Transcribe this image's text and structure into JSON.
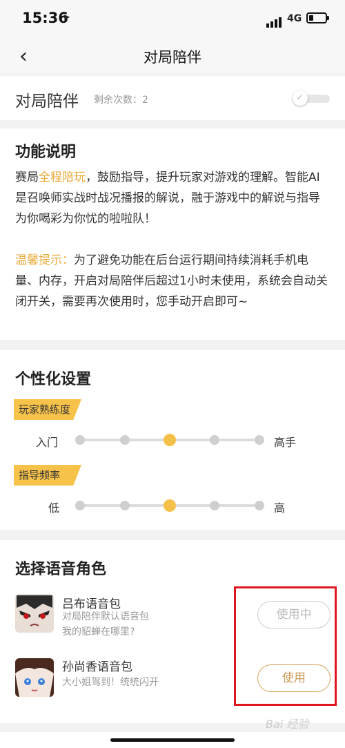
{
  "status_bar": {
    "time": "15:36",
    "network": "4G",
    "battery_level": 0.25
  },
  "header": {
    "title": "对局陪伴"
  },
  "toggle_section": {
    "label": "对局陪伴",
    "remaining": "剩余次数：2",
    "enabled": false
  },
  "description": {
    "title": "功能说明",
    "p1_a": "赛局",
    "p1_hl": "全程陪玩",
    "p1_b": "，鼓励指导，提升玩家对游戏的理解。智能AI是召唤师实战时战况播报的解说，融于游戏中的解说与指导为你喝彩为你忧的啦啦队！",
    "tip_hl": "温馨提示：",
    "tip_text": "为了避免功能在后台运行期间持续消耗手机电量、内存，开启对局陪伴后超过1小时未使用，系统会自动关闭开关，需要再次使用时，您手动开启即可~"
  },
  "personalization": {
    "title": "个性化设置",
    "skill": {
      "tag": "玩家熟练度",
      "min_label": "入门",
      "max_label": "高手",
      "steps": 5,
      "selected_index": 2
    },
    "frequency": {
      "tag": "指导频率",
      "min_label": "低",
      "max_label": "高",
      "steps": 5,
      "selected_index": 2
    }
  },
  "voices": {
    "title": "选择语音角色",
    "items": [
      {
        "name": "吕布语音包",
        "line1": "对局陪伴默认语音包",
        "line2": "我的貂蝉在哪里?",
        "button": "使用中"
      },
      {
        "name": "孙尚香语音包",
        "line1": "大小姐驾到！统统闪开",
        "line2": "",
        "button": "使用"
      }
    ]
  },
  "watermark": "Bai 经验"
}
